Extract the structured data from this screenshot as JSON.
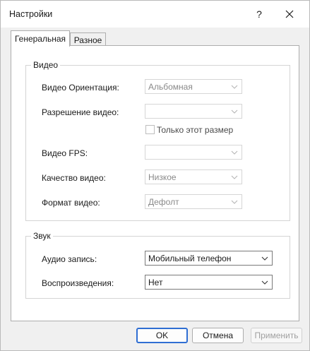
{
  "window": {
    "title": "Настройки",
    "help_label": "?"
  },
  "tabs": [
    {
      "label": "Генеральная",
      "active": true
    },
    {
      "label": "Разное",
      "active": false
    }
  ],
  "video": {
    "legend": "Видео",
    "orientation": {
      "label": "Видео Ориентация:",
      "value": "Альбомная",
      "enabled": false
    },
    "resolution": {
      "label": "Разрешение видео:",
      "value": "",
      "enabled": false
    },
    "only_this_size": {
      "label": "Только этот размер",
      "checked": false,
      "enabled": false
    },
    "fps": {
      "label": "Видео FPS:",
      "value": "",
      "enabled": false
    },
    "quality": {
      "label": "Качество видео:",
      "value": "Низкое",
      "enabled": false
    },
    "format": {
      "label": "Формат видео:",
      "value": "Дефолт",
      "enabled": false
    }
  },
  "sound": {
    "legend": "Звук",
    "audio_record": {
      "label": "Аудио запись:",
      "value": "Мобильный телефон",
      "enabled": true
    },
    "playback": {
      "label": "Воспроизведения:",
      "value": "Нет",
      "enabled": true
    }
  },
  "buttons": {
    "ok": "OK",
    "cancel": "Отмена",
    "apply": "Применить"
  },
  "colors": {
    "accent_border": "#2f6ed3",
    "disabled_text": "#8a8a8a"
  }
}
